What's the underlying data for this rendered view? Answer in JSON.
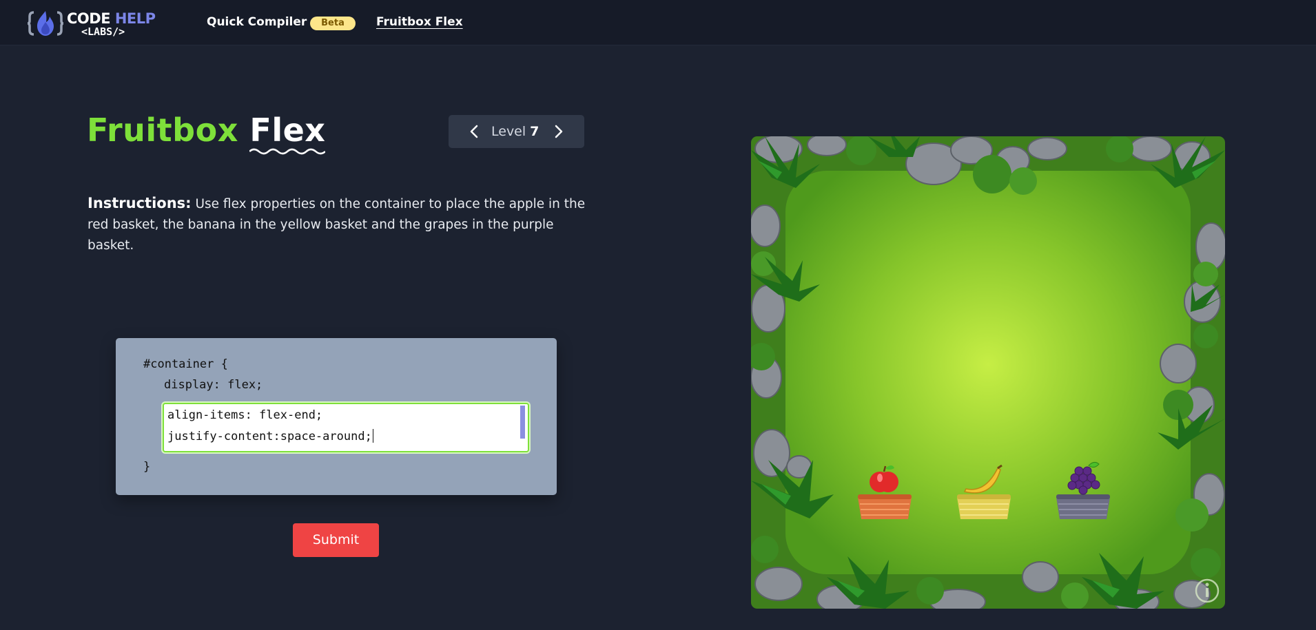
{
  "nav": {
    "logo_word1": "CODE",
    "logo_word2": "HELP",
    "logo_sub": "<LABS/>",
    "compiler_label": "Quick Compiler",
    "beta_badge": "Beta",
    "fruitbox_label": "Fruitbox Flex"
  },
  "title": {
    "part1": "Fruitbox",
    "part2": "Flex"
  },
  "level": {
    "label": "Level",
    "number": "7",
    "prev_icon": "chevron-left-icon",
    "next_icon": "chevron-right-icon"
  },
  "instructions": {
    "label": "Instructions:",
    "text": "Use flex properties on the container to place the apple in the red basket, the banana in the yellow basket and the grapes in the purple basket."
  },
  "editor": {
    "line_open": "#container {",
    "line_display": "display: flex;",
    "input_line1": "align-items: flex-end;",
    "input_line2": "justify-content:space-around;",
    "line_close": "}"
  },
  "submit_label": "Submit",
  "board": {
    "fruits": [
      "apple",
      "banana",
      "grapes"
    ],
    "baskets": [
      "red",
      "yellow",
      "purple"
    ],
    "info_icon": "info-icon"
  },
  "colors": {
    "background": "#1c2230",
    "accent_green": "#7ee03a",
    "submit_red": "#ef4444",
    "editor_bg": "#94a3b8"
  }
}
